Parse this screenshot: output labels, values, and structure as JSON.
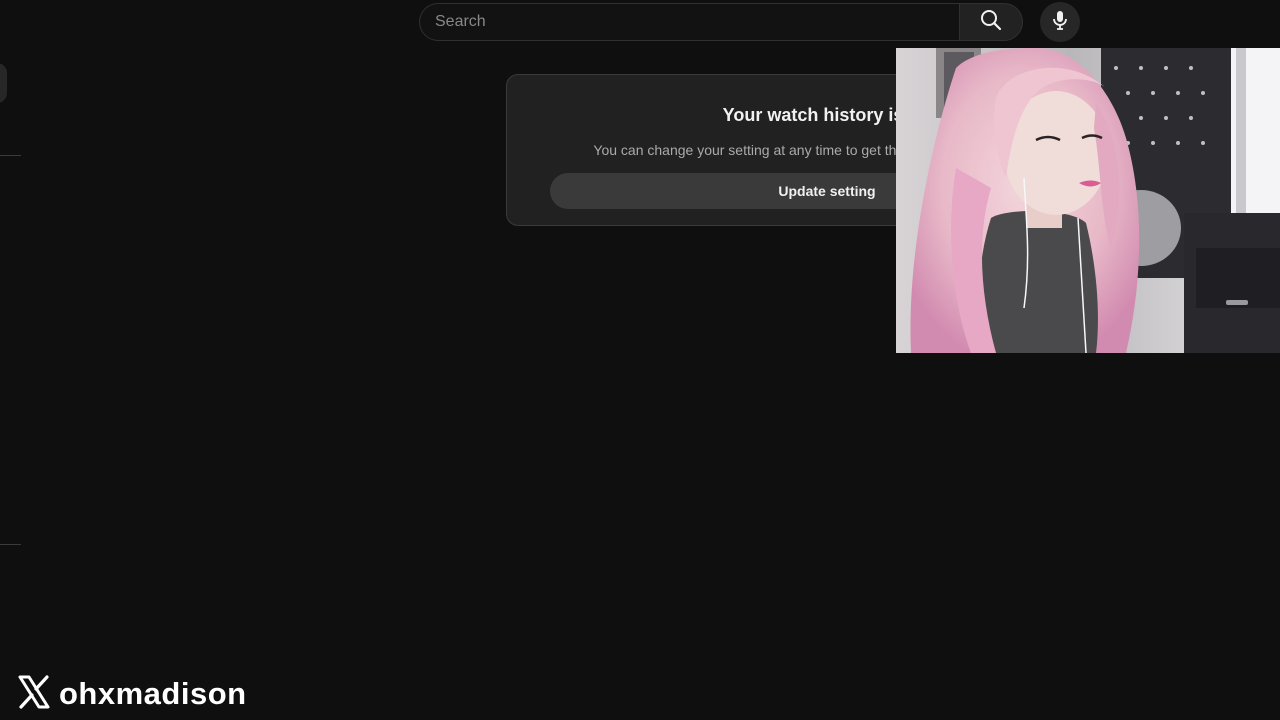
{
  "search": {
    "placeholder": "Search",
    "search_icon": "search-icon",
    "mic_icon": "microphone-icon"
  },
  "history_card": {
    "title": "Your watch history is off",
    "description": "You can change your setting at any time to get the latest recommendations.",
    "button_label": "Update setting"
  },
  "overlay": {
    "handle": "ohxmadison",
    "platform_icon": "x-logo-icon"
  },
  "colors": {
    "background": "#0f0f0f",
    "card": "#212121",
    "button": "#3a3a3a"
  }
}
